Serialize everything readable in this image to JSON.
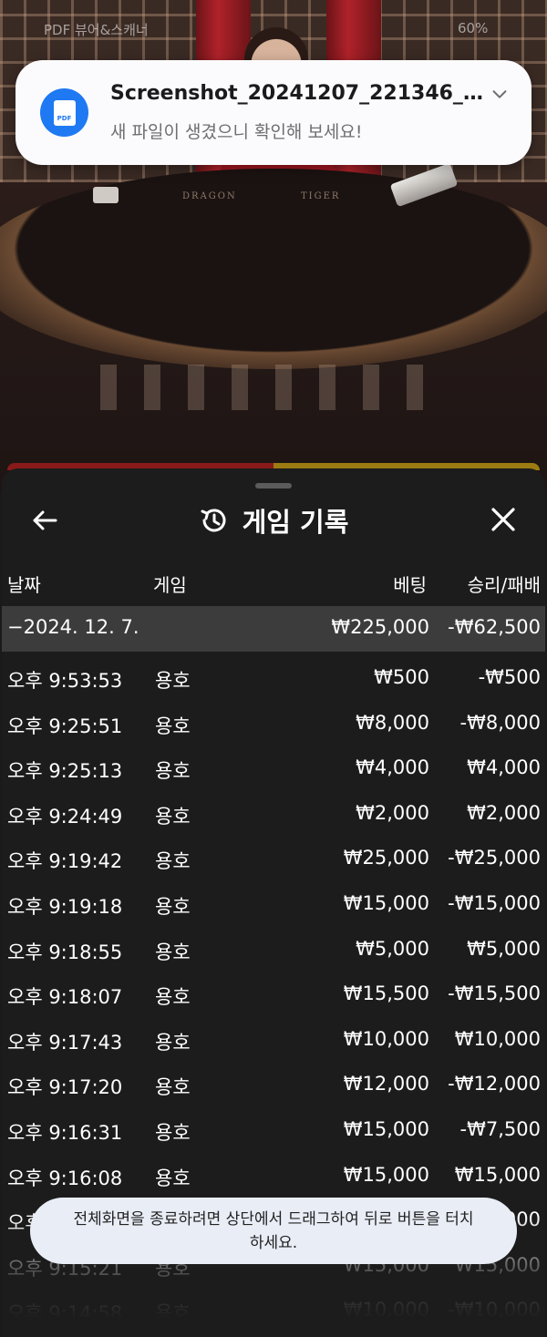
{
  "background": {
    "status_left": "PDF 뷰어&스캐너",
    "status_right": "60%",
    "table_left_label": "DRAGON",
    "table_right_label": "TIGER"
  },
  "notification": {
    "icon": "pdf-file-icon",
    "icon_label": "PDF",
    "title": "Screenshot_20241207_221346_C...",
    "body": "새 파일이 생겼으니 확인해 보세요!",
    "accent_color": "#1f79f2"
  },
  "sheet": {
    "title": "게임 기록",
    "columns": {
      "date": "날짜",
      "game": "게임",
      "bet": "베팅",
      "result": "승리/패배"
    },
    "summary": {
      "date": "−2024. 12. 7.",
      "bet": "₩225,000",
      "result": "-₩62,500"
    },
    "rows": [
      {
        "time": "오후 9:53:53",
        "game": "용호",
        "bet": "₩500",
        "result": "-₩500"
      },
      {
        "time": "오후 9:25:51",
        "game": "용호",
        "bet": "₩8,000",
        "result": "-₩8,000"
      },
      {
        "time": "오후 9:25:13",
        "game": "용호",
        "bet": "₩4,000",
        "result": "₩4,000"
      },
      {
        "time": "오후 9:24:49",
        "game": "용호",
        "bet": "₩2,000",
        "result": "₩2,000"
      },
      {
        "time": "오후 9:19:42",
        "game": "용호",
        "bet": "₩25,000",
        "result": "-₩25,000"
      },
      {
        "time": "오후 9:19:18",
        "game": "용호",
        "bet": "₩15,000",
        "result": "-₩15,000"
      },
      {
        "time": "오후 9:18:55",
        "game": "용호",
        "bet": "₩5,000",
        "result": "₩5,000"
      },
      {
        "time": "오후 9:18:07",
        "game": "용호",
        "bet": "₩15,500",
        "result": "-₩15,500"
      },
      {
        "time": "오후 9:17:43",
        "game": "용호",
        "bet": "₩10,000",
        "result": "₩10,000"
      },
      {
        "time": "오후 9:17:20",
        "game": "용호",
        "bet": "₩12,000",
        "result": "-₩12,000"
      },
      {
        "time": "오후 9:16:31",
        "game": "용호",
        "bet": "₩15,000",
        "result": "-₩7,500"
      },
      {
        "time": "오후 9:16:08",
        "game": "용호",
        "bet": "₩15,000",
        "result": "₩15,000"
      },
      {
        "time": "오후 9:15:44",
        "game": "용호",
        "bet": "₩15,000",
        "result": "₩15,000"
      },
      {
        "time": "오후 9:15:21",
        "game": "용호",
        "bet": "₩15,000",
        "result": "₩15,000"
      },
      {
        "time": "오후 9:14:58",
        "game": "용호",
        "bet": "₩10,000",
        "result": "-₩10,000"
      }
    ]
  },
  "toast": {
    "text": "전체화면을 종료하려면 상단에서 드래그하여 뒤로 버튼을 터치하세요."
  }
}
